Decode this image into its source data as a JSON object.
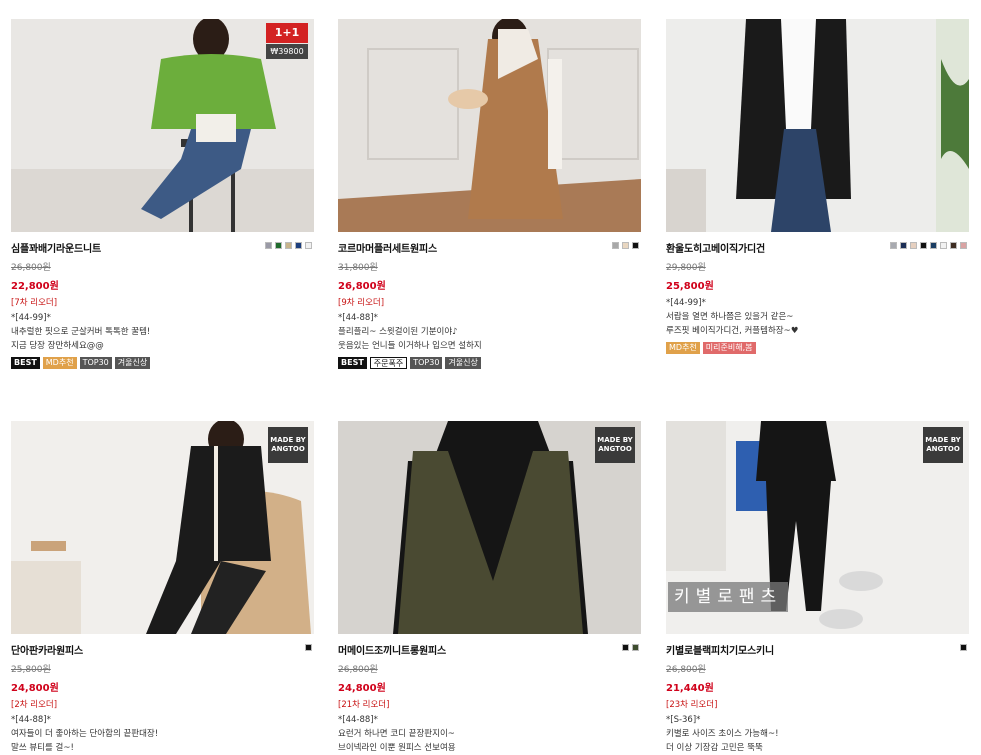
{
  "products": [
    {
      "name": "심플꽈배기라운드니트",
      "swatches": [
        "#9a9aa6",
        "#1f6b2c",
        "#c8b48c",
        "#1d3f7d",
        "#f2f2f2"
      ],
      "old_price": "26,800원",
      "price": "22,800원",
      "order": "[7차 리오더]",
      "desc": [
        "*[44-99]*",
        "내추럴한 핏으로 군살커버 톡톡한 꿀템!",
        "지금 당장 장만하세요@@"
      ],
      "badges": [
        "BEST",
        "MD추천",
        "TOP30",
        "겨울신상"
      ],
      "tag_top": "1+1",
      "tag_price": "₩39800",
      "image_colors": [
        "#e9e7e4",
        "#6cae3c"
      ]
    },
    {
      "name": "코르마머플러세트원피스",
      "swatches": [
        "#a8a8a8",
        "#e8d6c0",
        "#111111"
      ],
      "old_price": "31,800원",
      "price": "26,800원",
      "order": "[9차 리오더]",
      "desc": [
        "*[44-88]*",
        "플리플리~ 스윗걸이된 기분이야♪",
        "웃음있는 언니들 이거하나 입으면 설하지"
      ],
      "badges": [
        "BEST",
        "주문폭주",
        "TOP30",
        "겨울신상"
      ],
      "image_colors": [
        "#e4e1dd",
        "#b07a4c"
      ]
    },
    {
      "name": "환울도히고베이직가디건",
      "swatches": [
        "#a8aab0",
        "#1c2e55",
        "#e6d0c0",
        "#111111",
        "#1a3d63",
        "#f2f2f2",
        "#3d2c22",
        "#d9a3a3"
      ],
      "old_price": "29,800원",
      "price": "25,800원",
      "order": "",
      "desc": [
        "*[44-99]*",
        "서랍을 열면 하나쯤은 있을거 같은~",
        "루즈핏 베이직가디건, 커플템하장~♥"
      ],
      "badges": [
        "MD추천",
        "미리준비해,봄"
      ],
      "image_colors": [
        "#ededeb",
        "#1a1a1a"
      ]
    },
    {
      "name": "단아판카라원피스",
      "swatches": [
        "#111111"
      ],
      "old_price": "25,800원",
      "price": "24,800원",
      "order": "[2차 리오더]",
      "desc": [
        "*[44-88]*",
        "여자들이 더 좋아하는 단아함의 끝판대장!",
        "말쓰 뷰티를 걸~!"
      ],
      "badges": [],
      "tag_madeby": "MADE BY ANGTOO",
      "image_colors": [
        "#f1efec",
        "#1b1b1b"
      ]
    },
    {
      "name": "머메이드조끼니트롱원피스",
      "swatches": [
        "#111111",
        "#3e4d2e"
      ],
      "old_price": "26,800원",
      "price": "24,800원",
      "order": "[21차 리오더]",
      "desc": [
        "*[44-88]*",
        "요런거 하나면 코디 끝장판지이~",
        "브이넥라인 이뿐 원피스 선보여용"
      ],
      "badges": [],
      "tag_madeby": "MADE BY ANGTOO",
      "image_colors": [
        "#d6d3cf",
        "#4a4a32"
      ]
    },
    {
      "name": "키별로블랙피치기모스키니",
      "swatches": [
        "#111111"
      ],
      "old_price": "26,800원",
      "price": "21,440원",
      "order": "[23차 리오더]",
      "desc": [
        "*[S-36]*",
        "키별로 사이즈 초이스 가능해~!",
        "더 이상 기장감 고민은 뚝뚝"
      ],
      "badges": [],
      "tag_madeby": "MADE BY ANGTOO",
      "tag_overlay": "키별로팬츠",
      "image_colors": [
        "#f0efed",
        "#151515"
      ]
    }
  ]
}
